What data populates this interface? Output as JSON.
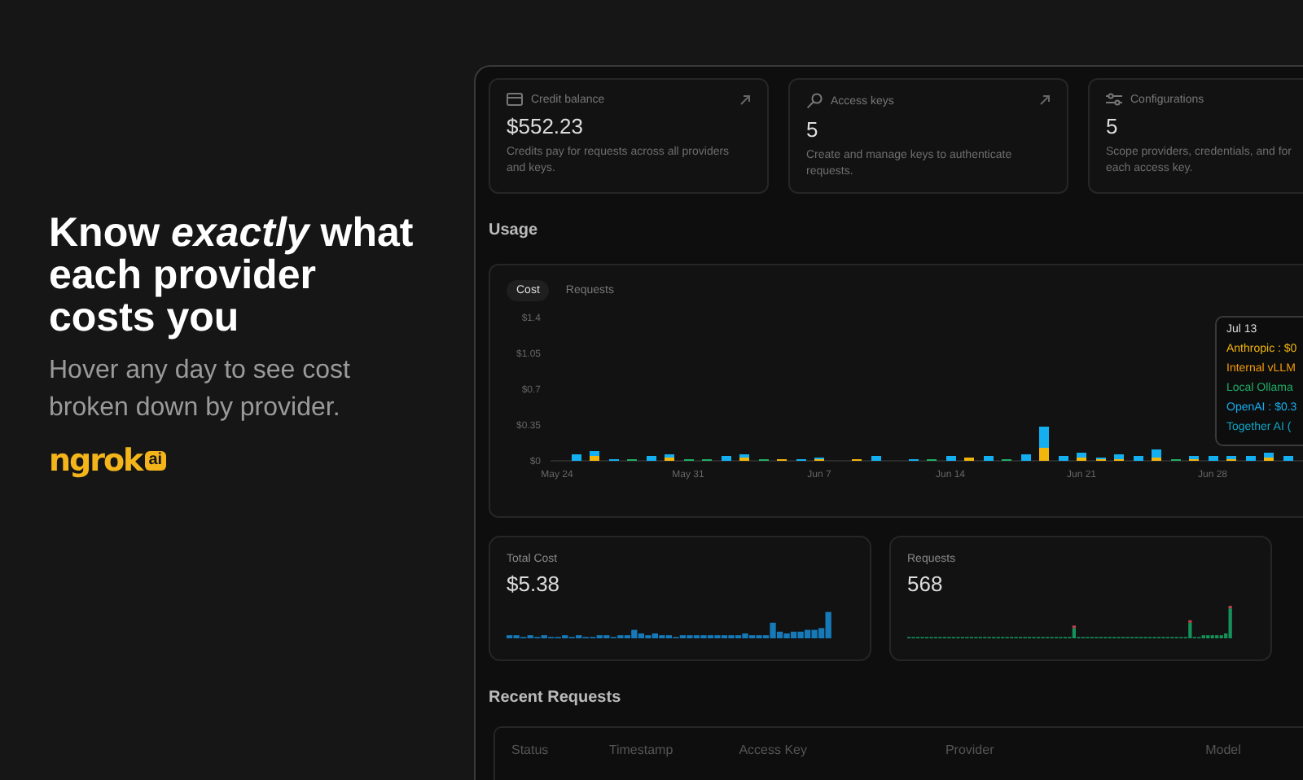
{
  "promo": {
    "headline": "Know *exactly* what each provider costs you",
    "subtitle": "Hover any day to see cost broken down by provider.",
    "logo": {
      "wordmark": "ngrok",
      "badge": "ai"
    }
  },
  "summary_cards": [
    {
      "kind": "credit",
      "title": "Credit balance",
      "value": "$552.23",
      "description": "Credits pay for requests across all providers and keys.",
      "link": true
    },
    {
      "kind": "key",
      "title": "Access keys",
      "value": "5",
      "description": "Create and manage keys to authenticate requests.",
      "link": true
    },
    {
      "kind": "config",
      "title": "Configurations",
      "value": "5",
      "description": "Scope providers, credentials, and for each access key.",
      "link": false
    }
  ],
  "usage": {
    "title": "Usage",
    "tabs": [
      {
        "label": "Cost",
        "selected": true
      },
      {
        "label": "Requests",
        "selected": false
      }
    ],
    "chart_data": {
      "type": "bar",
      "stacked": true,
      "ylim": [
        0,
        1.4
      ],
      "yticks": [
        {
          "value": 0,
          "label": "$0"
        },
        {
          "value": 0.35,
          "label": "$0.35"
        },
        {
          "value": 0.7,
          "label": "$0.7"
        },
        {
          "value": 1.05,
          "label": "$1.05"
        },
        {
          "value": 1.4,
          "label": "$1.4"
        }
      ],
      "categories": [
        "May 24",
        null,
        null,
        null,
        null,
        null,
        null,
        "May 31",
        null,
        null,
        null,
        null,
        null,
        null,
        "Jun 7",
        null,
        null,
        null,
        null,
        null,
        null,
        "Jun 14",
        null,
        null,
        null,
        null,
        null,
        null,
        "Jun 21",
        null,
        null,
        null,
        null,
        null,
        null,
        "Jun 28",
        null,
        null,
        null,
        null
      ],
      "series": [
        {
          "color": "#f2b50c",
          "values": [
            0,
            0,
            0.05,
            0,
            0,
            0,
            0.03,
            0,
            0,
            0,
            0.03,
            0,
            0.01,
            0,
            0.02,
            0,
            0.01,
            0,
            0,
            0,
            0,
            0,
            0.03,
            0,
            0,
            0,
            0.13,
            0,
            0.03,
            0.01,
            0.02,
            0,
            0.03,
            0,
            0.02,
            0,
            0.02,
            0,
            0.03,
            0
          ]
        },
        {
          "color": "#1fae66",
          "values": [
            0,
            0,
            0,
            0,
            0.01,
            0,
            0,
            0.01,
            0.01,
            0,
            0,
            0.01,
            0,
            0,
            0,
            0,
            0,
            0,
            0,
            0,
            0.01,
            0,
            0,
            0,
            0.01,
            0,
            0,
            0,
            0,
            0,
            0,
            0,
            0,
            0.01,
            0,
            0,
            0,
            0,
            0,
            0
          ]
        },
        {
          "color": "#14aff0",
          "values": [
            0,
            0.07,
            0.04,
            0.02,
            0,
            0.04,
            0.03,
            0,
            0,
            0.05,
            0.03,
            0,
            0,
            0.02,
            0.02,
            0,
            0,
            0.04,
            0,
            0.02,
            0,
            0.05,
            0,
            0.04,
            0,
            0.07,
            0.21,
            0.04,
            0.05,
            0.01,
            0.04,
            0.04,
            0.08,
            0,
            0.03,
            0.04,
            0.03,
            0.04,
            0.05,
            0.05
          ]
        }
      ]
    },
    "tooltip": {
      "title": "Jul 13",
      "items": [
        {
          "text": "Anthropic : $0",
          "color": "#f2b50c"
        },
        {
          "text": "Internal vLLM",
          "color": "#f29a0c"
        },
        {
          "text": "Local Ollama",
          "color": "#1fae66"
        },
        {
          "text": "OpenAI : $0.3",
          "color": "#14aff0"
        },
        {
          "text": "Together AI (",
          "color": "#0fa3c4"
        }
      ]
    }
  },
  "stats": [
    {
      "kind": "cost",
      "label": "Total Cost",
      "value": "$5.38"
    },
    {
      "kind": "requests",
      "label": "Requests",
      "value": "568"
    }
  ],
  "recent_requests": {
    "title": "Recent Requests",
    "columns": [
      "Status",
      "Timestamp",
      "Access Key",
      "Provider",
      "Model"
    ]
  }
}
